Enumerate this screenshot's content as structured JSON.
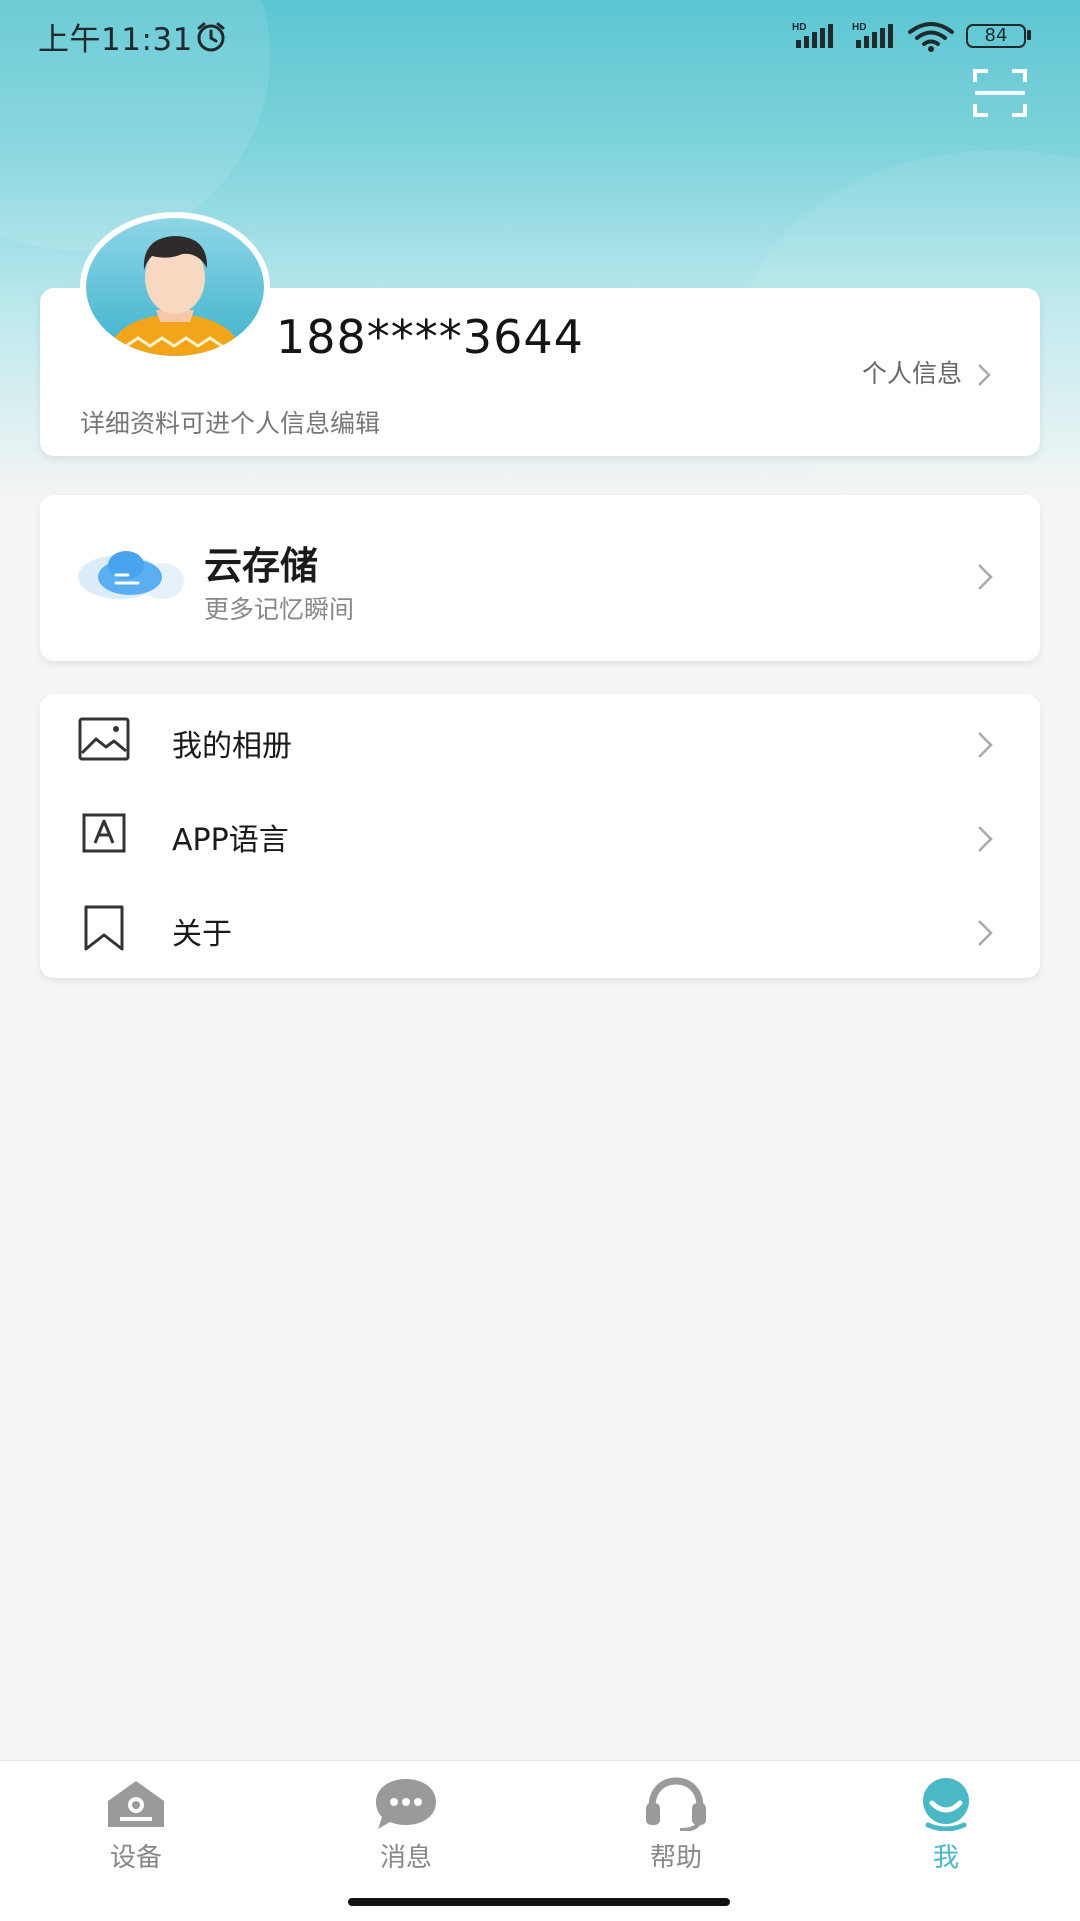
{
  "status_bar": {
    "time": "上午11:31",
    "signal_1": "HD",
    "signal_2": "HD",
    "battery": "84"
  },
  "header": {
    "scan_icon": "scan-icon"
  },
  "profile": {
    "phone": "188****3644",
    "personal_info_label": "个人信息",
    "hint": "详细资料可进个人信息编辑"
  },
  "cloud_storage": {
    "title": "云存储",
    "subtitle": "更多记忆瞬间"
  },
  "menu": {
    "items": [
      {
        "label": "我的相册",
        "icon": "album-icon"
      },
      {
        "label": "APP语言",
        "icon": "language-icon"
      },
      {
        "label": "关于",
        "icon": "bookmark-icon"
      }
    ]
  },
  "tabbar": {
    "tabs": [
      {
        "label": "设备",
        "icon": "device-icon"
      },
      {
        "label": "消息",
        "icon": "message-icon"
      },
      {
        "label": "帮助",
        "icon": "help-headset-icon"
      },
      {
        "label": "我",
        "icon": "me-icon"
      }
    ],
    "active_index": 3
  },
  "colors": {
    "accent": "#4bb8c6",
    "hero_top": "#5cc6d2",
    "background": "#f5f5f5"
  }
}
